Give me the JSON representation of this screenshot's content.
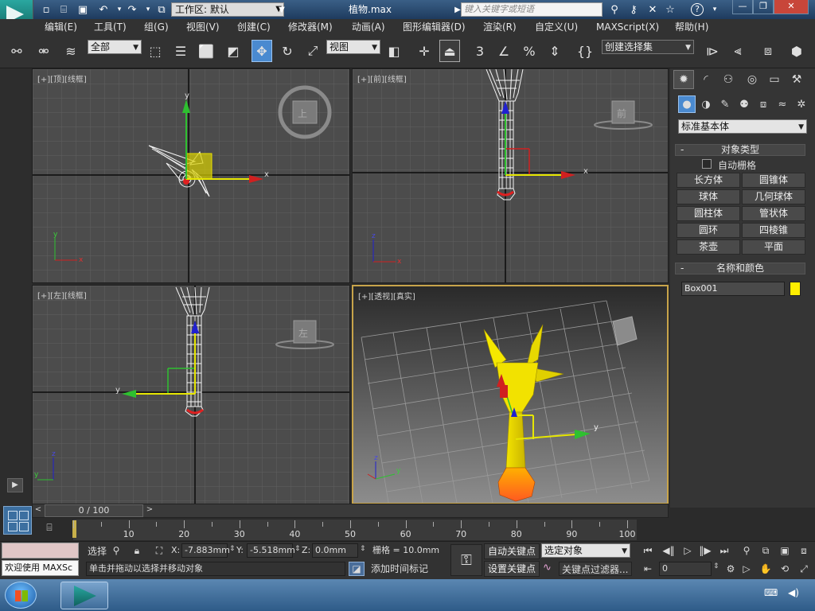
{
  "window": {
    "title": "植物.max",
    "workspace_label": "工作区: 默认",
    "search_placeholder": "键入关键字或短语",
    "help_label": "?",
    "controls": {
      "minimize": "—",
      "restore": "❐",
      "close": "✕"
    }
  },
  "menubar": {
    "items": [
      "编辑(E)",
      "工具(T)",
      "组(G)",
      "视图(V)",
      "创建(C)",
      "修改器(M)",
      "动画(A)",
      "图形编辑器(D)",
      "渲染(R)",
      "自定义(U)",
      "MAXScript(X)",
      "帮助(H)"
    ]
  },
  "toolbar": {
    "selection_filter": "全部",
    "ref_coord": "视图",
    "named_selection_set": "创建选择集",
    "snap_label": "3",
    "percent_label": "%"
  },
  "viewports": {
    "top": {
      "label": "[+][顶][线框]",
      "viewcube_face": "上"
    },
    "front": {
      "label": "[+][前][线框]",
      "viewcube_face": "前"
    },
    "left": {
      "label": "[+][左][线框]",
      "viewcube_face": "左"
    },
    "perspective": {
      "label": "[+][透视][真实]"
    },
    "axis_labels": {
      "x": "x",
      "y": "y",
      "z": "z"
    }
  },
  "command_panel": {
    "category_dropdown": "标准基本体",
    "object_type": {
      "title": "对象类型",
      "autogrid_label": "自动栅格",
      "buttons": [
        "长方体",
        "圆锥体",
        "球体",
        "几何球体",
        "圆柱体",
        "管状体",
        "圆环",
        "四棱锥",
        "茶壶",
        "平面"
      ]
    },
    "name_color": {
      "title": "名称和颜色",
      "object_name": "Box001",
      "color": "#ffee00"
    }
  },
  "timeline": {
    "frame_counter": "0 / 100",
    "ticks": [
      "10",
      "20",
      "30",
      "40",
      "50",
      "60",
      "70",
      "80",
      "90",
      "100"
    ]
  },
  "statusbar": {
    "maxscript_listener": "欢迎使用 MAXSc",
    "select_label": "选择",
    "x_label": "X:",
    "y_label": "Y:",
    "z_label": "Z:",
    "x_value": "-7.883mm",
    "y_value": "-5.518mm",
    "z_value": "0.0mm",
    "grid": "栅格 = 10.0mm",
    "prompt": "单击并拖动以选择并移动对象",
    "add_time_tag": "添加时间标记",
    "auto_key": "自动关键点",
    "set_key": "设置关键点",
    "selected_object": "选定对象",
    "key_filters": "关键点过滤器...",
    "current_frame": "0"
  }
}
